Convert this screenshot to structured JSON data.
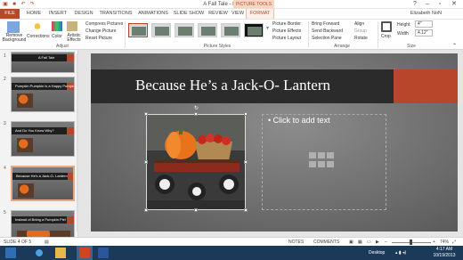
{
  "window": {
    "title": "A Fall Tale - PowerPoint",
    "context_label": "PICTURE TOOLS"
  },
  "tabs": [
    "FILE",
    "HOME",
    "INSERT",
    "DESIGN",
    "TRANSITIONS",
    "ANIMATIONS",
    "SLIDE SHOW",
    "REVIEW",
    "VIEW",
    "FORMAT"
  ],
  "user": "Elizabeth NoN",
  "ribbon": {
    "adjust": {
      "remove_background": "Remove Background",
      "corrections": "Corrections",
      "color": "Color",
      "artistic_effects": "Artistic Effects",
      "compress": "Compress Pictures",
      "change": "Change Picture",
      "reset": "Reset Picture",
      "group_label": "Adjust"
    },
    "picture_styles": {
      "group_label": "Picture Styles",
      "border": "Picture Border",
      "effects": "Picture Effects",
      "layout": "Picture Layout"
    },
    "arrange": {
      "bring_forward": "Bring Forward",
      "send_backward": "Send Backward",
      "selection_pane": "Selection Pane",
      "align": "Align",
      "group": "Group",
      "rotate": "Rotate",
      "group_label": "Arrange"
    },
    "size": {
      "crop": "Crop",
      "height_label": "Height",
      "height_value": "4\"",
      "width_label": "Width",
      "width_value": "4.12\"",
      "group_label": "Size"
    }
  },
  "slides": [
    {
      "num": "1",
      "title": "A Fall Tale"
    },
    {
      "num": "2",
      "title": "Pumpkin Pumpkin is a Happy Pumpkin"
    },
    {
      "num": "3",
      "title": "And Do You Know Why?"
    },
    {
      "num": "4",
      "title": "Because He's a Jack-O- Lantern"
    },
    {
      "num": "5",
      "title": "Instead of Being a Pumpkin Pie!"
    }
  ],
  "slide": {
    "title": "Because He’s a Jack-O- Lantern",
    "placeholder": "Click to add text"
  },
  "status": {
    "slide_of": "SLIDE 4 OF 5",
    "notes": "NOTES",
    "comments": "COMMENTS",
    "zoom": "74%"
  },
  "taskbar": {
    "desktop": "Desktop",
    "time": "4:17 AM",
    "date": "10/19/2013"
  },
  "colors": {
    "accent": "#b7472a",
    "title_bar": "#2b2b2b",
    "taskbar": "#1b3a5a"
  }
}
